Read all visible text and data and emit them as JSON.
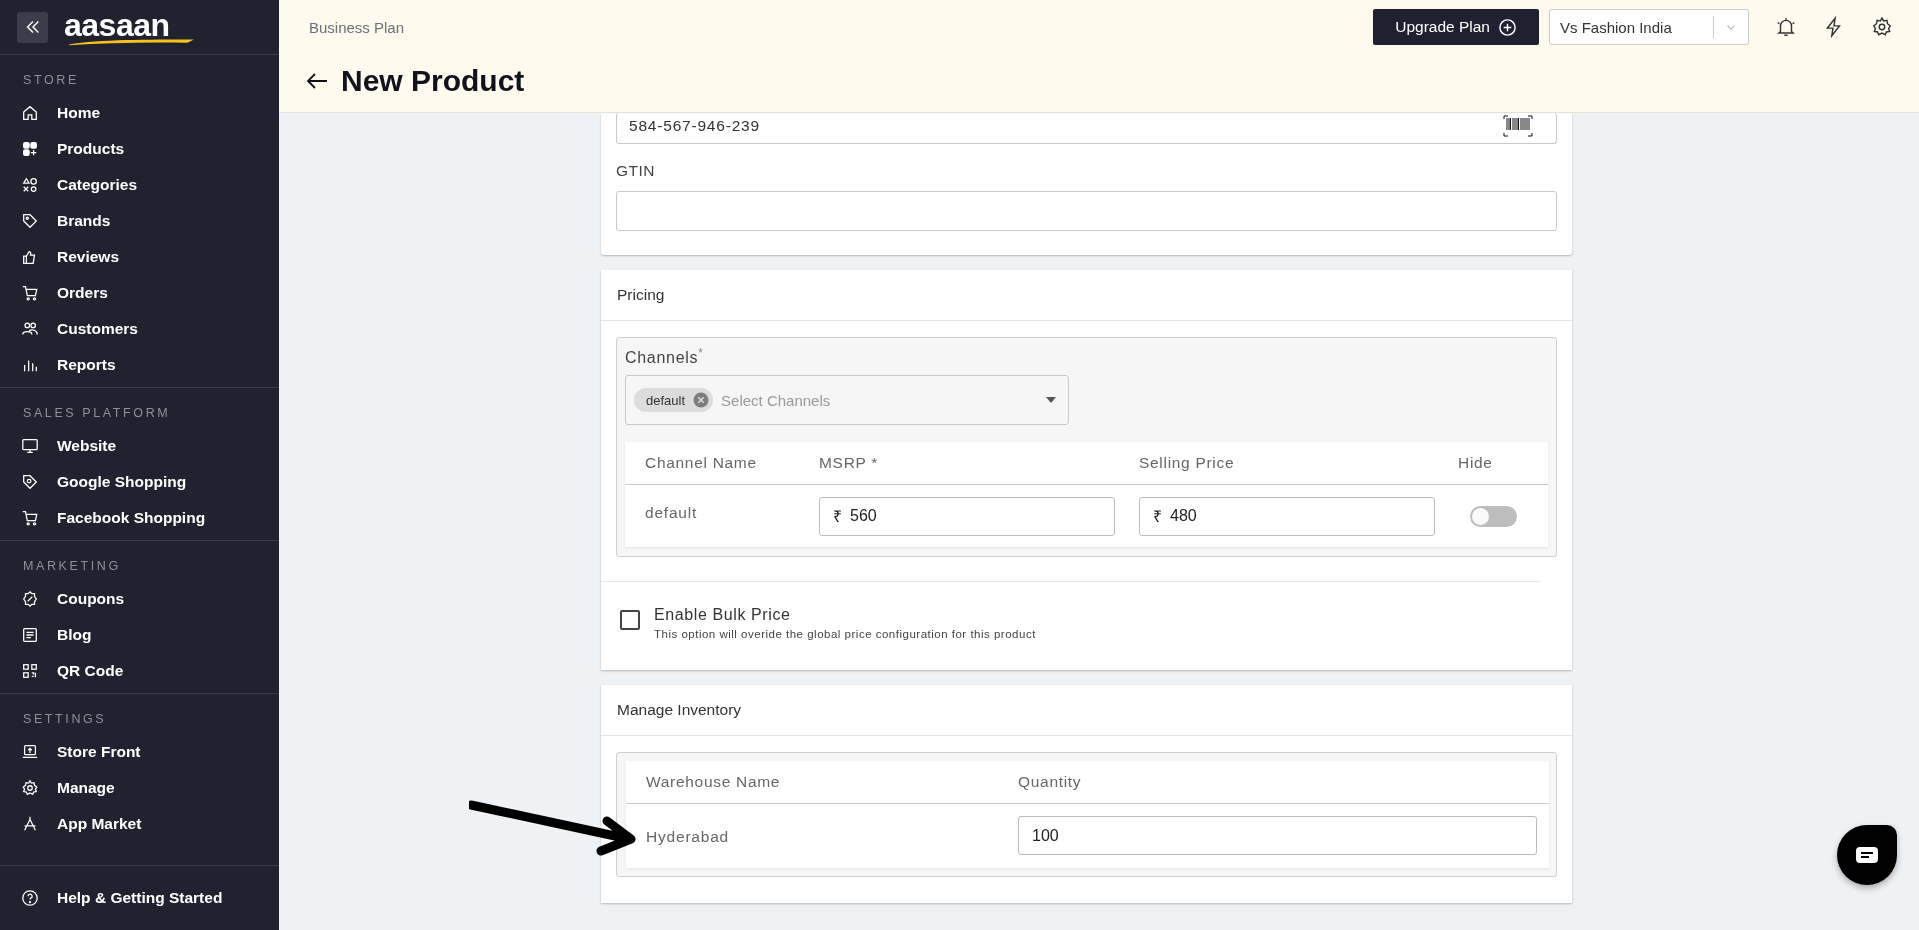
{
  "sidebar": {
    "logo": "aasaan",
    "sections": [
      {
        "title": "STORE",
        "items": [
          "Home",
          "Products",
          "Categories",
          "Brands",
          "Reviews",
          "Orders",
          "Customers",
          "Reports"
        ]
      },
      {
        "title": "SALES PLATFORM",
        "items": [
          "Website",
          "Google Shopping",
          "Facebook Shopping"
        ]
      },
      {
        "title": "MARKETING",
        "items": [
          "Coupons",
          "Blog",
          "QR Code"
        ]
      },
      {
        "title": "SETTINGS",
        "items": [
          "Store Front",
          "Manage",
          "App Market"
        ]
      }
    ],
    "footer_item": "Help & Getting Started"
  },
  "header": {
    "plan": "Business Plan",
    "title": "New Product",
    "upgrade_button": "Upgrade Plan",
    "store_select": "Vs Fashion India"
  },
  "identifier_card": {
    "code_value": "584-567-946-239",
    "gtin_label": "GTIN"
  },
  "pricing": {
    "title": "Pricing",
    "channels_label": "Channels",
    "required_mark": "*",
    "chips": [
      "default"
    ],
    "placeholder": "Select Channels",
    "columns": [
      "Channel Name",
      "MSRP *",
      "Selling Price",
      "Hide"
    ],
    "rows": [
      {
        "channel": "default",
        "msrp_currency": "₹",
        "msrp": "560",
        "selling_currency": "₹",
        "selling_price": "480",
        "hidden": false
      }
    ],
    "bulk_price": {
      "label": "Enable Bulk Price",
      "hint": "This option will overide the global price configuration for this product",
      "checked": false
    }
  },
  "inventory": {
    "title": "Manage Inventory",
    "columns": [
      "Warehouse Name",
      "Quantity"
    ],
    "rows": [
      {
        "warehouse": "Hyderabad",
        "quantity": "100"
      }
    ]
  }
}
